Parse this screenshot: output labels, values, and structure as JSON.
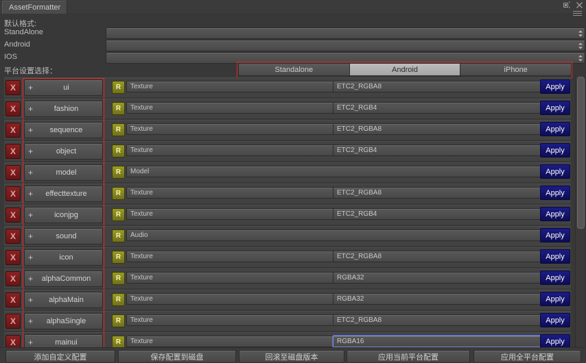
{
  "window": {
    "tab_title": "AssetFormatter",
    "maximize_icon": "maximize-icon",
    "close_icon": "close-icon",
    "menu_icon": "hamburger-menu-icon"
  },
  "defaults": {
    "section_label": "默认格式:",
    "rows": [
      {
        "label": "StandAlone",
        "value": ""
      },
      {
        "label": "Android",
        "value": ""
      },
      {
        "label": "IOS",
        "value": ""
      }
    ]
  },
  "platform": {
    "label": "平台设置选择：",
    "options": [
      "Standalone",
      "Android",
      "iPhone"
    ],
    "selected": "Android",
    "highlight_color": "#ee2222"
  },
  "colors": {
    "accent_red": "#ee2222",
    "delete_button": "#7a1f1f",
    "revert_button": "#8a8a18",
    "apply_button": "#141470",
    "focus_border": "#7b8dd4",
    "panel_bg": "#383838",
    "row_bg": "#424242"
  },
  "table": {
    "delete_label": "X",
    "revert_label": "R",
    "add_label": "+",
    "apply_label": "Apply",
    "rows": [
      {
        "name": "ui",
        "type": "Texture",
        "format": "ETC2_RGBA8",
        "focused": false
      },
      {
        "name": "fashion",
        "type": "Texture",
        "format": "ETC2_RGB4",
        "focused": false
      },
      {
        "name": "sequence",
        "type": "Texture",
        "format": "ETC2_RGBA8",
        "focused": false
      },
      {
        "name": "object",
        "type": "Texture",
        "format": "ETC2_RGB4",
        "focused": false
      },
      {
        "name": "model",
        "type": "Model",
        "format": null,
        "focused": false
      },
      {
        "name": "effecttexture",
        "type": "Texture",
        "format": "ETC2_RGBA8",
        "focused": false
      },
      {
        "name": "iconjpg",
        "type": "Texture",
        "format": "ETC2_RGB4",
        "focused": false
      },
      {
        "name": "sound",
        "type": "Audio",
        "format": null,
        "focused": false
      },
      {
        "name": "icon",
        "type": "Texture",
        "format": "ETC2_RGBA8",
        "focused": false
      },
      {
        "name": "alphaCommon",
        "type": "Texture",
        "format": "RGBA32",
        "focused": false
      },
      {
        "name": "alphaMain",
        "type": "Texture",
        "format": "RGBA32",
        "focused": false
      },
      {
        "name": "alphaSingle",
        "type": "Texture",
        "format": "ETC2_RGBA8",
        "focused": false
      },
      {
        "name": "mainui",
        "type": "Texture",
        "format": "RGBA16",
        "focused": true
      }
    ]
  },
  "bottom_toolbar": {
    "buttons": [
      "添加自定义配置",
      "保存配置到磁盘",
      "回滚至磁盘版本",
      "应用当前平台配置",
      "应用全平台配置"
    ]
  },
  "scrollbar": {
    "orientation": "vertical",
    "thumb_position_percent": 0
  }
}
